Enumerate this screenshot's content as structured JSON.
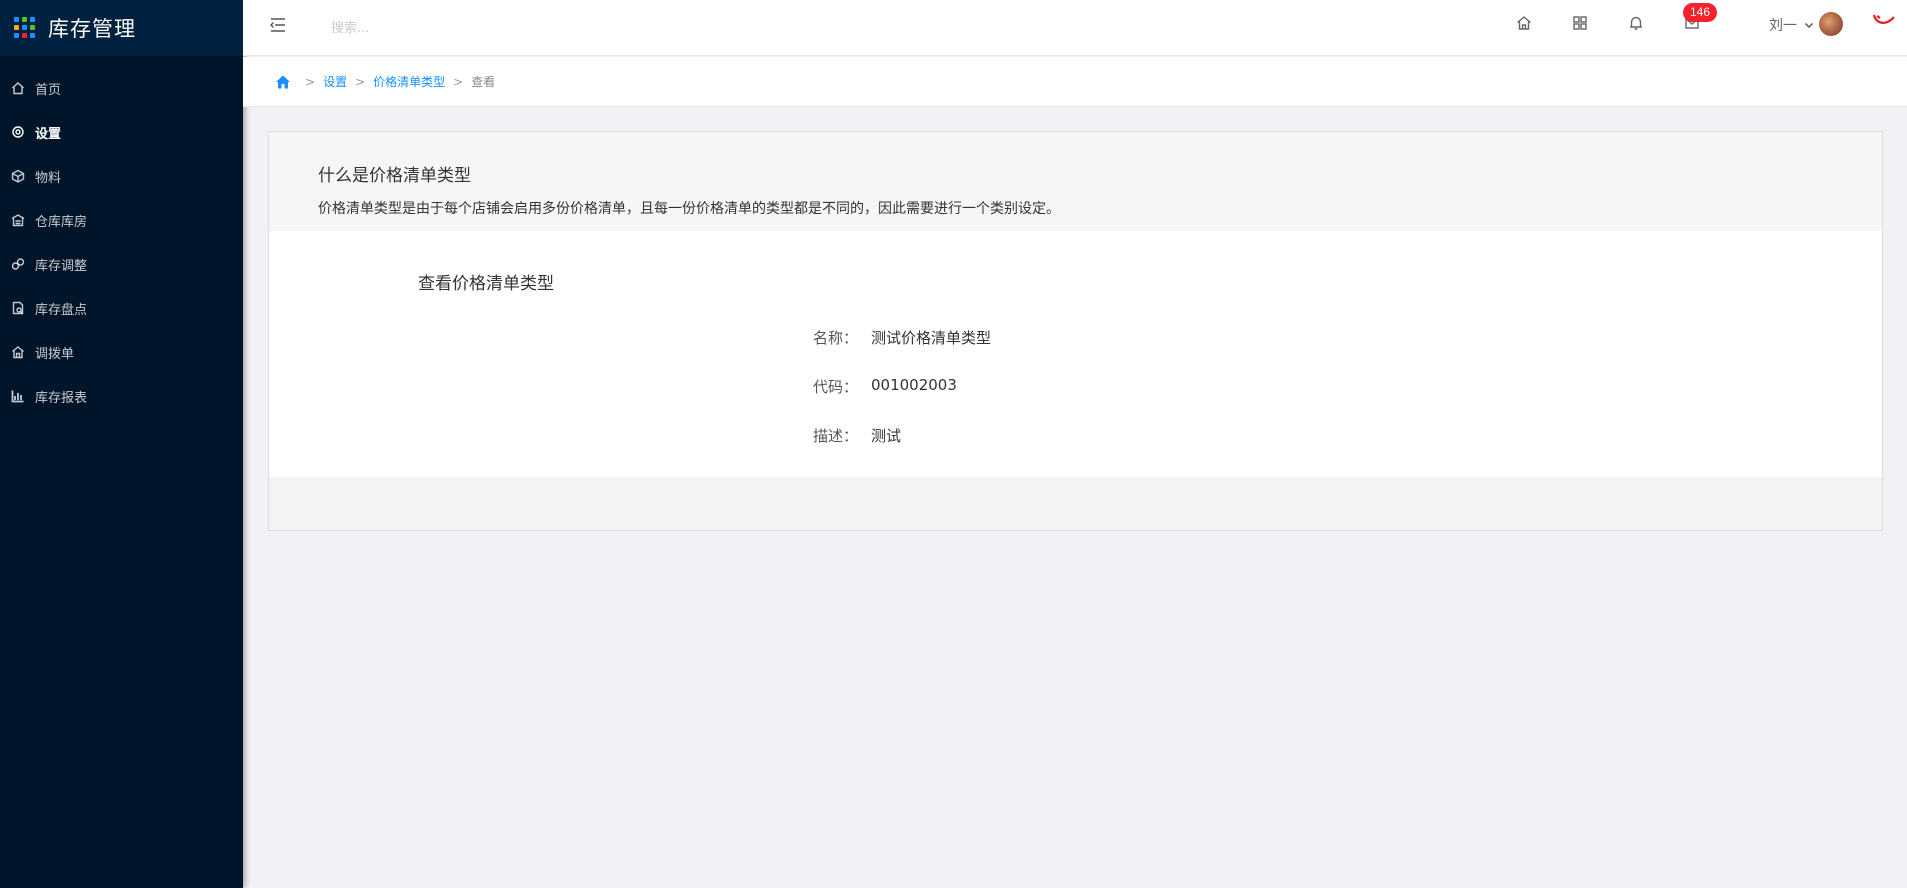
{
  "app": {
    "title": "库存管理"
  },
  "sidebar": {
    "items": [
      {
        "label": "首页",
        "icon": "home-icon",
        "active": false
      },
      {
        "label": "设置",
        "icon": "gear-icon",
        "active": true
      },
      {
        "label": "物料",
        "icon": "cube-icon",
        "active": false
      },
      {
        "label": "仓库库房",
        "icon": "warehouse-icon",
        "active": false
      },
      {
        "label": "库存调整",
        "icon": "adjust-icon",
        "active": false
      },
      {
        "label": "库存盘点",
        "icon": "inventory-check-icon",
        "active": false
      },
      {
        "label": "调拨单",
        "icon": "transfer-icon",
        "active": false
      },
      {
        "label": "库存报表",
        "icon": "bar-chart-icon",
        "active": false
      }
    ]
  },
  "header": {
    "search": {
      "placeholder": "搜索...",
      "value": ""
    },
    "message_count": "146",
    "user_name": "刘一"
  },
  "breadcrumb": {
    "items": [
      "设置",
      "价格清单类型"
    ],
    "current": "查看",
    "separator": ">"
  },
  "intro": {
    "title": "什么是价格清单类型",
    "description": "价格清单类型是由于每个店铺会启用多份价格清单，且每一份价格清单的类型都是不同的，因此需要进行一个类别设定。"
  },
  "detail": {
    "title": "查看价格清单类型",
    "fields": [
      {
        "label": "名称：",
        "value": "测试价格清单类型"
      },
      {
        "label": "代码：",
        "value": "001002003"
      },
      {
        "label": "描述：",
        "value": "测试"
      }
    ]
  },
  "colors": {
    "sidebar_bg": "#001529",
    "accent": "#1890ff",
    "badge": "#f5222d"
  }
}
